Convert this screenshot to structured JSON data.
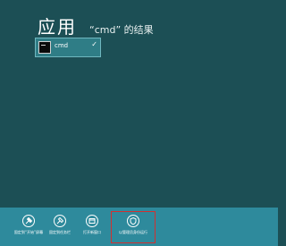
{
  "header": {
    "title": "应用",
    "subtitle": "“cmd” 的结果"
  },
  "results": [
    {
      "label": "cmd",
      "selected": true,
      "check_mark": "✓"
    }
  ],
  "app_bar": {
    "commands": [
      {
        "icon": "pin-icon",
        "label": "固定到“开始”屏幕"
      },
      {
        "icon": "pin-taskbar-icon",
        "label": "固定到任务栏"
      },
      {
        "icon": "new-window-icon",
        "label": "打开新窗口"
      },
      {
        "icon": "shield-admin-icon",
        "label": "以管理员身份运行"
      }
    ],
    "highlighted_command_index": 3
  },
  "colors": {
    "background": "#1c4f55",
    "app_bar": "#2e8a9c",
    "tile": "#2f7d86",
    "highlight": "#d23030"
  }
}
